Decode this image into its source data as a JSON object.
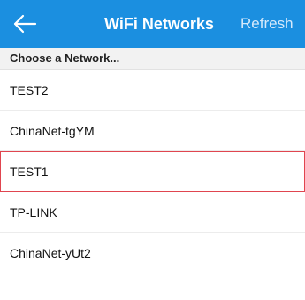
{
  "navbar": {
    "back_icon": "arrow-left-icon",
    "title": "WiFi Networks",
    "refresh_label": "Refresh",
    "background_color": "#1b8fe0"
  },
  "section": {
    "header": "Choose a Network..."
  },
  "networks": [
    {
      "ssid": "TEST2",
      "selected": false
    },
    {
      "ssid": "ChinaNet-tgYM",
      "selected": false
    },
    {
      "ssid": "TEST1",
      "selected": true
    },
    {
      "ssid": "TP-LINK",
      "selected": false
    },
    {
      "ssid": "ChinaNet-yUt2",
      "selected": false
    }
  ],
  "colors": {
    "selection_border": "#e0454f"
  }
}
